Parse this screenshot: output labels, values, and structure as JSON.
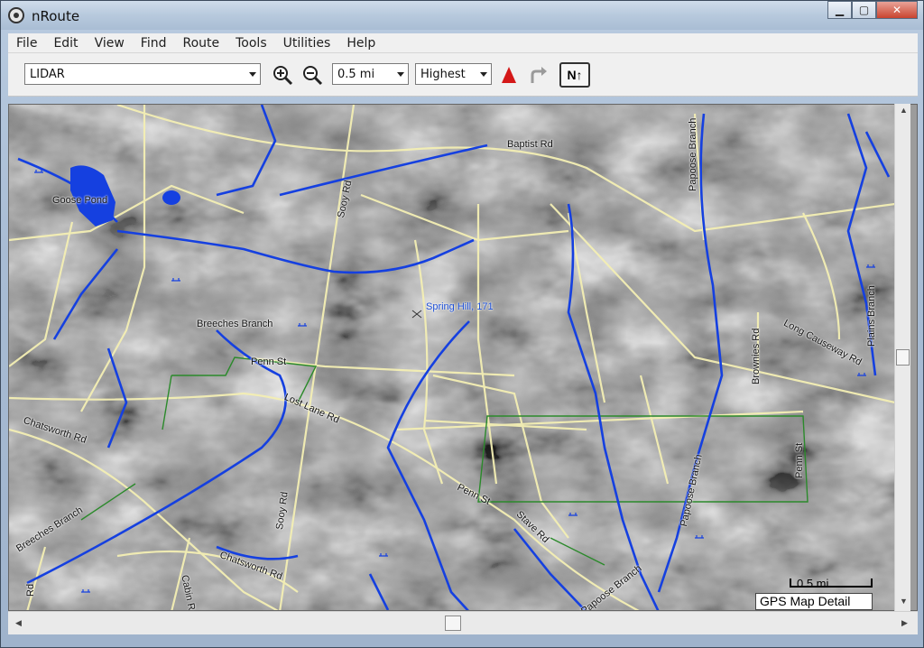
{
  "window": {
    "title": "nRoute"
  },
  "menu": [
    "File",
    "Edit",
    "View",
    "Find",
    "Route",
    "Tools",
    "Utilities",
    "Help"
  ],
  "toolbar": {
    "layer_select": "LIDAR",
    "scale_select": "0.5 mi",
    "detail_select": "Highest",
    "north_button": "N↑"
  },
  "map": {
    "labels": {
      "goose_pond": "Goose Pond",
      "baptist_rd": "Baptist Rd",
      "soy_rd_north": "Sooy Rd",
      "soy_rd_south": "Sooy Rd",
      "papoose_branch_north": "Papoose Branch",
      "papoose_branch_mid": "Papoose Branch",
      "papoose_branch_south": "Papoose Branch",
      "plains_branch": "Plains Branch",
      "long_causeway_rd": "Long Causeway Rd",
      "brownies_rd": "Brownies Rd",
      "spring_hill": "Spring Hill, 171",
      "breeches_branch_north": "Breeches Branch",
      "breeches_branch_south": "Breeches Branch",
      "penn_st_west": "Penn St",
      "penn_st_mid": "Penn St",
      "penn_st_east": "Penn St",
      "lost_lane_rd": "Lost Lane Rd",
      "chatsworth_rd_west": "Chatsworth Rd",
      "chatsworth_rd_south": "Chatsworth Rd",
      "stave_rd": "Stave Rd",
      "cabin_rd": "Cabin Rd",
      "road_edge": "Rd"
    },
    "scale_label": "0.5 mi",
    "detail_label": "GPS Map Detail"
  },
  "colors": {
    "water": "#1540e0",
    "roads": "#f4efb4",
    "trails": "#2b8a2b",
    "terrain_light": "#e6e6e6",
    "terrain_dark": "#3c3c3c"
  }
}
